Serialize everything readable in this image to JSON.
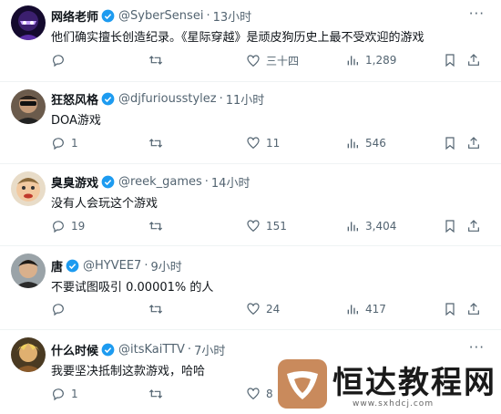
{
  "tweets": [
    {
      "name": "网络老师",
      "handle": "@SyberSensei",
      "time": "13小时",
      "text": "他们确实擅长创造纪录。《星际穿越》是顽皮狗历史上最不受欢迎的游戏",
      "replies": "",
      "retweets": "",
      "likes": "三十四",
      "views": "1,289",
      "avatar_icon": "purple-masked-avatar"
    },
    {
      "name": "狂怒风格",
      "handle": "@djfuriousstylez",
      "time": "11小时",
      "text": "DOA游戏",
      "replies": "1",
      "retweets": "",
      "likes": "11",
      "views": "546",
      "avatar_icon": "sunglasses-man-avatar"
    },
    {
      "name": "臭臭游戏",
      "handle": "@reek_games",
      "time": "14小时",
      "text": "没有人会玩这个游戏",
      "replies": "19",
      "retweets": "",
      "likes": "151",
      "views": "3,404",
      "avatar_icon": "cartoon-face-avatar"
    },
    {
      "name": "唐",
      "handle": "@HYVEE7",
      "time": "9小时",
      "text": "不要试图吸引 0.00001% 的人",
      "replies": "",
      "retweets": "",
      "likes": "24",
      "views": "417",
      "avatar_icon": "dark-haired-man-avatar"
    },
    {
      "name": "什么时候",
      "handle": "@itsKaiTTV",
      "time": "7小时",
      "text": "我要坚决抵制这款游戏，哈哈",
      "replies": "1",
      "retweets": "",
      "likes": "8",
      "views": "",
      "avatar_icon": "game-character-avatar"
    }
  ],
  "separator": "·",
  "more_label": "···",
  "watermark": {
    "title": "恒达教程网",
    "url": "www.sxhdcj.com"
  },
  "colors": {
    "text": "#0f1419",
    "muted": "#536471",
    "verified": "#1d9bf0",
    "divider": "#eff3f4"
  }
}
